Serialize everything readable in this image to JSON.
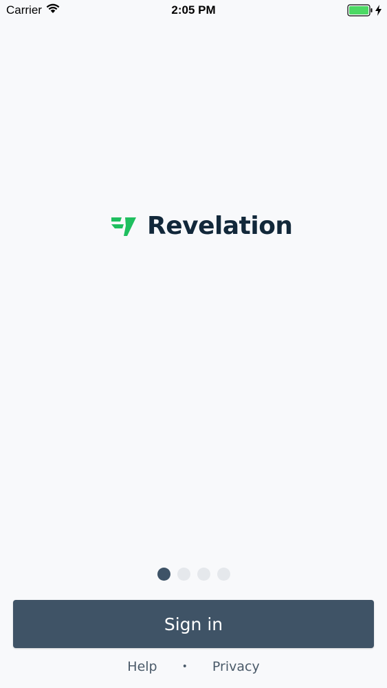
{
  "status_bar": {
    "carrier": "Carrier",
    "time": "2:05 PM",
    "battery_color": "#4cd964"
  },
  "brand": {
    "name": "Revelation",
    "mark_color": "#1fbf5f",
    "text_color": "#12283a"
  },
  "pager": {
    "count": 4,
    "active_index": 0
  },
  "actions": {
    "sign_in_label": "Sign in"
  },
  "footer": {
    "help_label": "Help",
    "separator": "•",
    "privacy_label": "Privacy"
  }
}
